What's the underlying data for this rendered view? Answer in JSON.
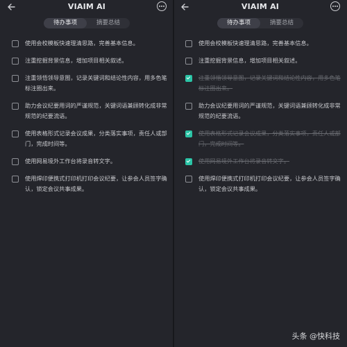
{
  "app": {
    "title": "VIAIM AI",
    "tabs": [
      "待办事项",
      "摘要总结"
    ]
  },
  "left_items": [
    {
      "text": "使用会校模板快速理清思路，完善基本信息。",
      "checked": false
    },
    {
      "text": "注重挖掘背景信息，增加项目相关叙述。",
      "checked": false
    },
    {
      "text": "注重领悟领导意图，记录关键词和结论性内容，用多色笔标注圈出来。",
      "checked": false
    },
    {
      "text": "助力会议纪要用词的严谨规范，关键词语兼顾转化成非常规范的纪要流语。",
      "checked": false
    },
    {
      "text": "使用表格形式记录会议成果，分类落实事项，责任人或部门，完成时间等。",
      "checked": false
    },
    {
      "text": "使用网易境外工作台将录音转文字。",
      "checked": false
    },
    {
      "text": "使用焊印便携式打印机打印会议纪要，让参会人员签字确认，锁定会议共事成果。",
      "checked": false
    }
  ],
  "right_items": [
    {
      "text": "使用会校模板快速理清思路，完善基本信息。",
      "checked": false
    },
    {
      "text": "注重挖掘背景信息，增加项目相关叙述。",
      "checked": false
    },
    {
      "text": "注重领悟领导意图，记录关键词和结论性内容，用多色笔标注圈出来。",
      "checked": true
    },
    {
      "text": "助力会议纪要用词的严谨规范，关键词语兼顾转化成非常规范的纪要流语。",
      "checked": false
    },
    {
      "text": "使用表格形式记录会议成果，分类落实事项，责任人或部门，完成时间等。",
      "checked": true
    },
    {
      "text": "使用网易境外工作台将录音转文字。",
      "checked": true
    },
    {
      "text": "使用焊印便携式打印机打印会议纪要，让参会人员签字确认，锁定会议共事成果。",
      "checked": false
    }
  ],
  "watermark": "头条 @快科技",
  "colors": {
    "check_accent": "#2bc4a6",
    "background": "#24252b"
  }
}
